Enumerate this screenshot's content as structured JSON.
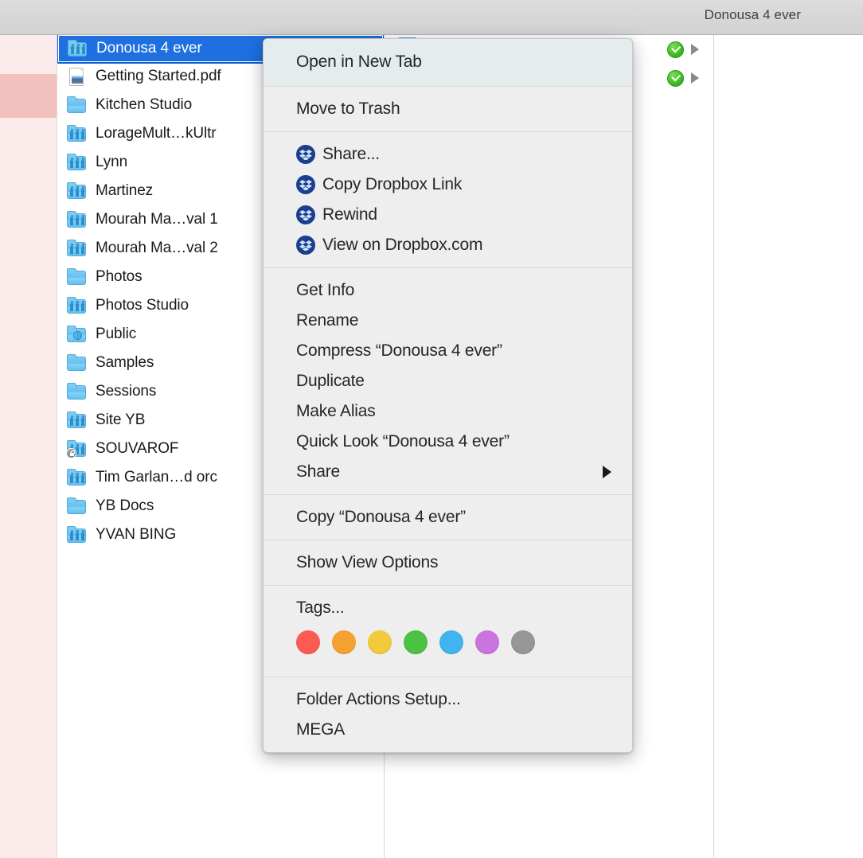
{
  "window": {
    "title": "Donousa 4 ever"
  },
  "file_list": {
    "items": [
      {
        "name": "Donousa 4 ever",
        "icon": "shared-folder-icon",
        "selected": true
      },
      {
        "name": "Getting Started.pdf",
        "icon": "pdf-document-icon",
        "selected": false
      },
      {
        "name": "Kitchen Studio",
        "icon": "folder-icon",
        "selected": false
      },
      {
        "name": "LorageMult…kUltr",
        "icon": "shared-folder-icon",
        "selected": false
      },
      {
        "name": "Lynn",
        "icon": "shared-folder-icon",
        "selected": false
      },
      {
        "name": "Martinez",
        "icon": "shared-folder-icon",
        "selected": false
      },
      {
        "name": "Mourah Ma…val 1",
        "icon": "shared-folder-icon",
        "selected": false
      },
      {
        "name": "Mourah Ma…val 2",
        "icon": "shared-folder-icon",
        "selected": false
      },
      {
        "name": "Photos",
        "icon": "folder-icon",
        "selected": false
      },
      {
        "name": "Photos Studio",
        "icon": "shared-folder-icon",
        "selected": false
      },
      {
        "name": "Public",
        "icon": "public-folder-icon",
        "selected": false
      },
      {
        "name": "Samples",
        "icon": "folder-icon",
        "selected": false
      },
      {
        "name": "Sessions",
        "icon": "folder-icon",
        "selected": false
      },
      {
        "name": "Site YB",
        "icon": "shared-folder-icon",
        "selected": false
      },
      {
        "name": "SOUVAROF",
        "icon": "locked-shared-folder-icon",
        "selected": false
      },
      {
        "name": "Tim Garlan…d orc",
        "icon": "shared-folder-icon",
        "selected": false
      },
      {
        "name": "YB Docs",
        "icon": "folder-icon",
        "selected": false
      },
      {
        "name": "YVAN BING",
        "icon": "shared-folder-icon",
        "selected": false
      }
    ]
  },
  "sync_badges": [
    {
      "status_icon": "green-check-icon",
      "disclosure_icon": "triangle-right-icon"
    },
    {
      "status_icon": "green-check-icon",
      "disclosure_icon": "triangle-right-icon"
    }
  ],
  "context_menu": {
    "sections": [
      {
        "items": [
          {
            "label": "Open in New Tab"
          }
        ]
      },
      {
        "items": [
          {
            "label": "Move to Trash"
          }
        ]
      },
      {
        "items": [
          {
            "label": "Share...",
            "icon": "dropbox-icon"
          },
          {
            "label": "Copy Dropbox Link",
            "icon": "dropbox-icon"
          },
          {
            "label": "Rewind",
            "icon": "dropbox-icon"
          },
          {
            "label": "View on Dropbox.com",
            "icon": "dropbox-icon"
          }
        ]
      },
      {
        "items": [
          {
            "label": "Get Info"
          },
          {
            "label": "Rename"
          },
          {
            "label": "Compress “Donousa 4 ever”"
          },
          {
            "label": "Duplicate"
          },
          {
            "label": "Make Alias"
          },
          {
            "label": "Quick Look “Donousa 4 ever”"
          },
          {
            "label": "Share",
            "submenu": true
          }
        ]
      },
      {
        "items": [
          {
            "label": "Copy “Donousa 4 ever”"
          }
        ]
      },
      {
        "items": [
          {
            "label": "Show View Options"
          }
        ]
      },
      {
        "items": [
          {
            "label": "Tags..."
          }
        ]
      },
      {
        "items": [
          {
            "label": "Folder Actions Setup..."
          },
          {
            "label": "MEGA"
          }
        ]
      }
    ],
    "tag_colors": [
      {
        "name": "red",
        "hex": "#fb5b53"
      },
      {
        "name": "orange",
        "hex": "#f5a132"
      },
      {
        "name": "yellow",
        "hex": "#f2cb3c"
      },
      {
        "name": "green",
        "hex": "#4cc242"
      },
      {
        "name": "blue",
        "hex": "#40b4ef"
      },
      {
        "name": "purple",
        "hex": "#cb73e0"
      },
      {
        "name": "gray",
        "hex": "#969696"
      }
    ]
  },
  "colors": {
    "selection_blue": "#1e6fe0",
    "menu_background": "#eeeeee",
    "menu_highlight": "#e4ecee",
    "titlebar": "#d6d6d6",
    "preview_column_pink": "#fbeaea",
    "preview_selected_pink": "#f2c0bd",
    "dropbox_blue": "#1b3e91",
    "sync_green": "#41bf27"
  }
}
